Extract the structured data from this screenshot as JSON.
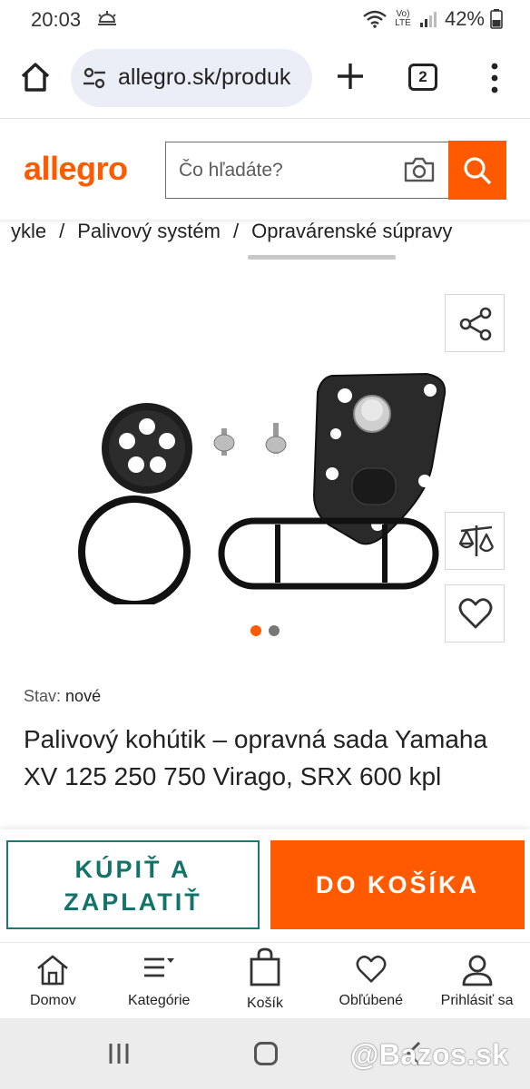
{
  "status_bar": {
    "time": "20:03",
    "network": "Vo) LTE",
    "battery": "42%"
  },
  "browser": {
    "url": "allegro.sk/produk",
    "tab_count": "2",
    "icons": [
      "home-icon",
      "tune-icon",
      "plus-icon",
      "tabs-icon",
      "more-vert-icon"
    ]
  },
  "header": {
    "logo": "allegro",
    "search_placeholder": "Čo hľadáte?",
    "brand_color": "#ff5a00"
  },
  "breadcrumb": {
    "items": [
      "ykle",
      "Palivový systém",
      "Opravárenské súpravy"
    ],
    "separator": "/"
  },
  "gallery": {
    "image_count": 2,
    "active_index": 0,
    "actions": [
      "share-icon",
      "compare-icon",
      "heart-icon"
    ]
  },
  "product": {
    "condition_label": "Stav:",
    "condition_value": "nové",
    "title": "Palivový kohútik – opravná sada Yamaha XV 125 250 750 Virago, SRX 600 kpl"
  },
  "cta": {
    "buy_line1": "KÚPIŤ A",
    "buy_line2": "ZAPLATIŤ",
    "cart": "DO KOŠÍKA",
    "buy_color": "#137369",
    "cart_color": "#ff5a00"
  },
  "bottom_nav": {
    "items": [
      {
        "label": "Domov",
        "icon": "home-icon"
      },
      {
        "label": "Kategórie",
        "icon": "menu-icon"
      },
      {
        "label": "Košík",
        "icon": "bag-icon"
      },
      {
        "label": "Obľúbené",
        "icon": "heart-icon"
      },
      {
        "label": "Prihlásiť sa",
        "icon": "user-icon"
      }
    ]
  },
  "watermark": "@Bazos.sk"
}
